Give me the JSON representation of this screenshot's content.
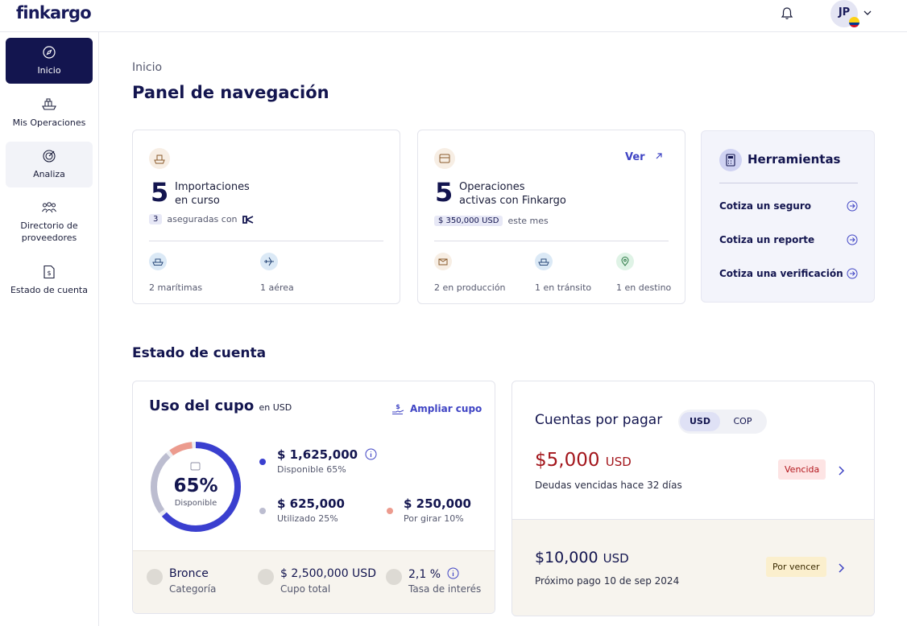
{
  "header": {
    "logo": "finkargo",
    "user_initials": "JP"
  },
  "sidebar": {
    "items": [
      {
        "label": "Inicio",
        "icon": "compass-icon",
        "active": true
      },
      {
        "label": "Mis Operaciones",
        "icon": "ship-icon"
      },
      {
        "label": "Analiza",
        "icon": "target-icon"
      },
      {
        "label": "Directorio de proveedores",
        "icon": "people-icon"
      },
      {
        "label": "Estado de cuenta",
        "icon": "document-dollar-icon"
      }
    ]
  },
  "breadcrumb": "Inicio",
  "page_title": "Panel de navegación",
  "importaciones": {
    "count": "5",
    "title_line1": "Importaciones",
    "title_line2": "en curso",
    "insured_count": "3",
    "insured_text": "aseguradas con",
    "stats": [
      {
        "label": "2 marítimas",
        "icon": "ship-icon"
      },
      {
        "label": "1 aérea",
        "icon": "plane-icon"
      }
    ]
  },
  "operaciones": {
    "count": "5",
    "title_line1": "Operaciones",
    "title_line2": "activas con Finkargo",
    "link": "Ver",
    "amount_chip": "$ 350,000 USD",
    "period": "este mes",
    "stats": [
      {
        "label": "2 en producción",
        "icon": "box-icon"
      },
      {
        "label": "1 en tránsito",
        "icon": "ship-icon"
      },
      {
        "label": "1 en destino",
        "icon": "pin-icon"
      }
    ]
  },
  "herramientas": {
    "title": "Herramientas",
    "items": [
      "Cotiza un seguro",
      "Cotiza un reporte",
      "Cotiza una verificación"
    ]
  },
  "estado_title": "Estado de cuenta",
  "cupo": {
    "title": "Uso del cupo",
    "unit": "en USD",
    "ampliar": "Ampliar cupo",
    "percent": "65%",
    "percent_label": "Disponible",
    "disponible": {
      "amount": "$ 1,625,000",
      "desc": "Disponible 65%"
    },
    "utilizado": {
      "amount": "$ 625,000",
      "desc": "Utilizado 25%"
    },
    "por_girar": {
      "amount": "$ 250,000",
      "desc": "Por girar 10%"
    },
    "breakdown": {
      "disponible": 65,
      "utilizado": 25,
      "por_girar": 10
    },
    "footer": [
      {
        "value": "Bronce",
        "label": "Categoría"
      },
      {
        "value": "$ 2,500,000 USD",
        "label": "Cupo total"
      },
      {
        "value": "2,1 %",
        "label": "Tasa de interés"
      }
    ]
  },
  "cuentas": {
    "title": "Cuentas por pagar",
    "toggle": [
      "USD",
      "COP"
    ],
    "vencida": {
      "amount": "$5,000",
      "currency": "USD",
      "desc": "Deudas vencidas hace 32 días",
      "badge": "Vencida"
    },
    "por_vencer": {
      "amount": "$10,000",
      "currency": "USD",
      "desc": "Próximo pago 10 de sep 2024",
      "badge": "Por vencer"
    }
  },
  "colors": {
    "primary": "#13154f",
    "accent": "#3f44c4",
    "danger": "#a3161c",
    "salmon": "#ec9b8e",
    "gray": "#bcbdd0"
  }
}
